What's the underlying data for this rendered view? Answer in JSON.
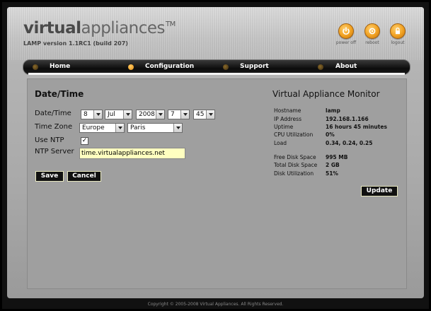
{
  "header": {
    "logo_bold": "virtual",
    "logo_light": "appliances",
    "logo_tm": "TM",
    "version": "LAMP version 1.1RC1 (build 207)",
    "buttons": [
      {
        "label": "power off",
        "icon": "power-icon"
      },
      {
        "label": "reboot",
        "icon": "reboot-icon"
      },
      {
        "label": "logout",
        "icon": "lock-icon"
      }
    ]
  },
  "nav": {
    "items": [
      {
        "label": "Home",
        "active": false
      },
      {
        "label": "Configuration",
        "active": true
      },
      {
        "label": "Support",
        "active": false
      },
      {
        "label": "About",
        "active": false
      }
    ]
  },
  "form": {
    "title": "Date/Time",
    "date_label": "Date/Time",
    "day": "8",
    "month": "Jul",
    "year": "2008",
    "hour": "7",
    "minute": "45",
    "timezone_label": "Time Zone",
    "region": "Europe",
    "city": "Paris",
    "use_ntp_label": "Use NTP",
    "use_ntp_checked": true,
    "use_ntp_mark": "✓",
    "ntp_server_label": "NTP Server",
    "ntp_server_value": "time.virtualappliances.net",
    "save_label": "Save",
    "cancel_label": "Cancel"
  },
  "monitor": {
    "title": "Virtual Appliance Monitor",
    "rows": [
      {
        "key": "Hostname",
        "value": "lamp"
      },
      {
        "key": "IP Address",
        "value": "192.168.1.166"
      },
      {
        "key": "Uptime",
        "value": "16 hours 45 minutes"
      },
      {
        "key": "CPU Utilization",
        "value": "0%"
      },
      {
        "key": "Load",
        "value": "0.34, 0.24, 0.25"
      },
      {
        "key": "Free Disk Space",
        "value": "995 MB"
      },
      {
        "key": "Total Disk Space",
        "value": "2 GB"
      },
      {
        "key": "Disk Utilization",
        "value": "51%"
      }
    ],
    "update_label": "Update"
  },
  "footer": {
    "copyright": "Copyright © 2005-2008 Virtual Appliances. All Rights Reserved."
  },
  "colors": {
    "accent": "#f0a020",
    "panel": "#9f9f9f",
    "ntp_field": "#ffffc0"
  }
}
